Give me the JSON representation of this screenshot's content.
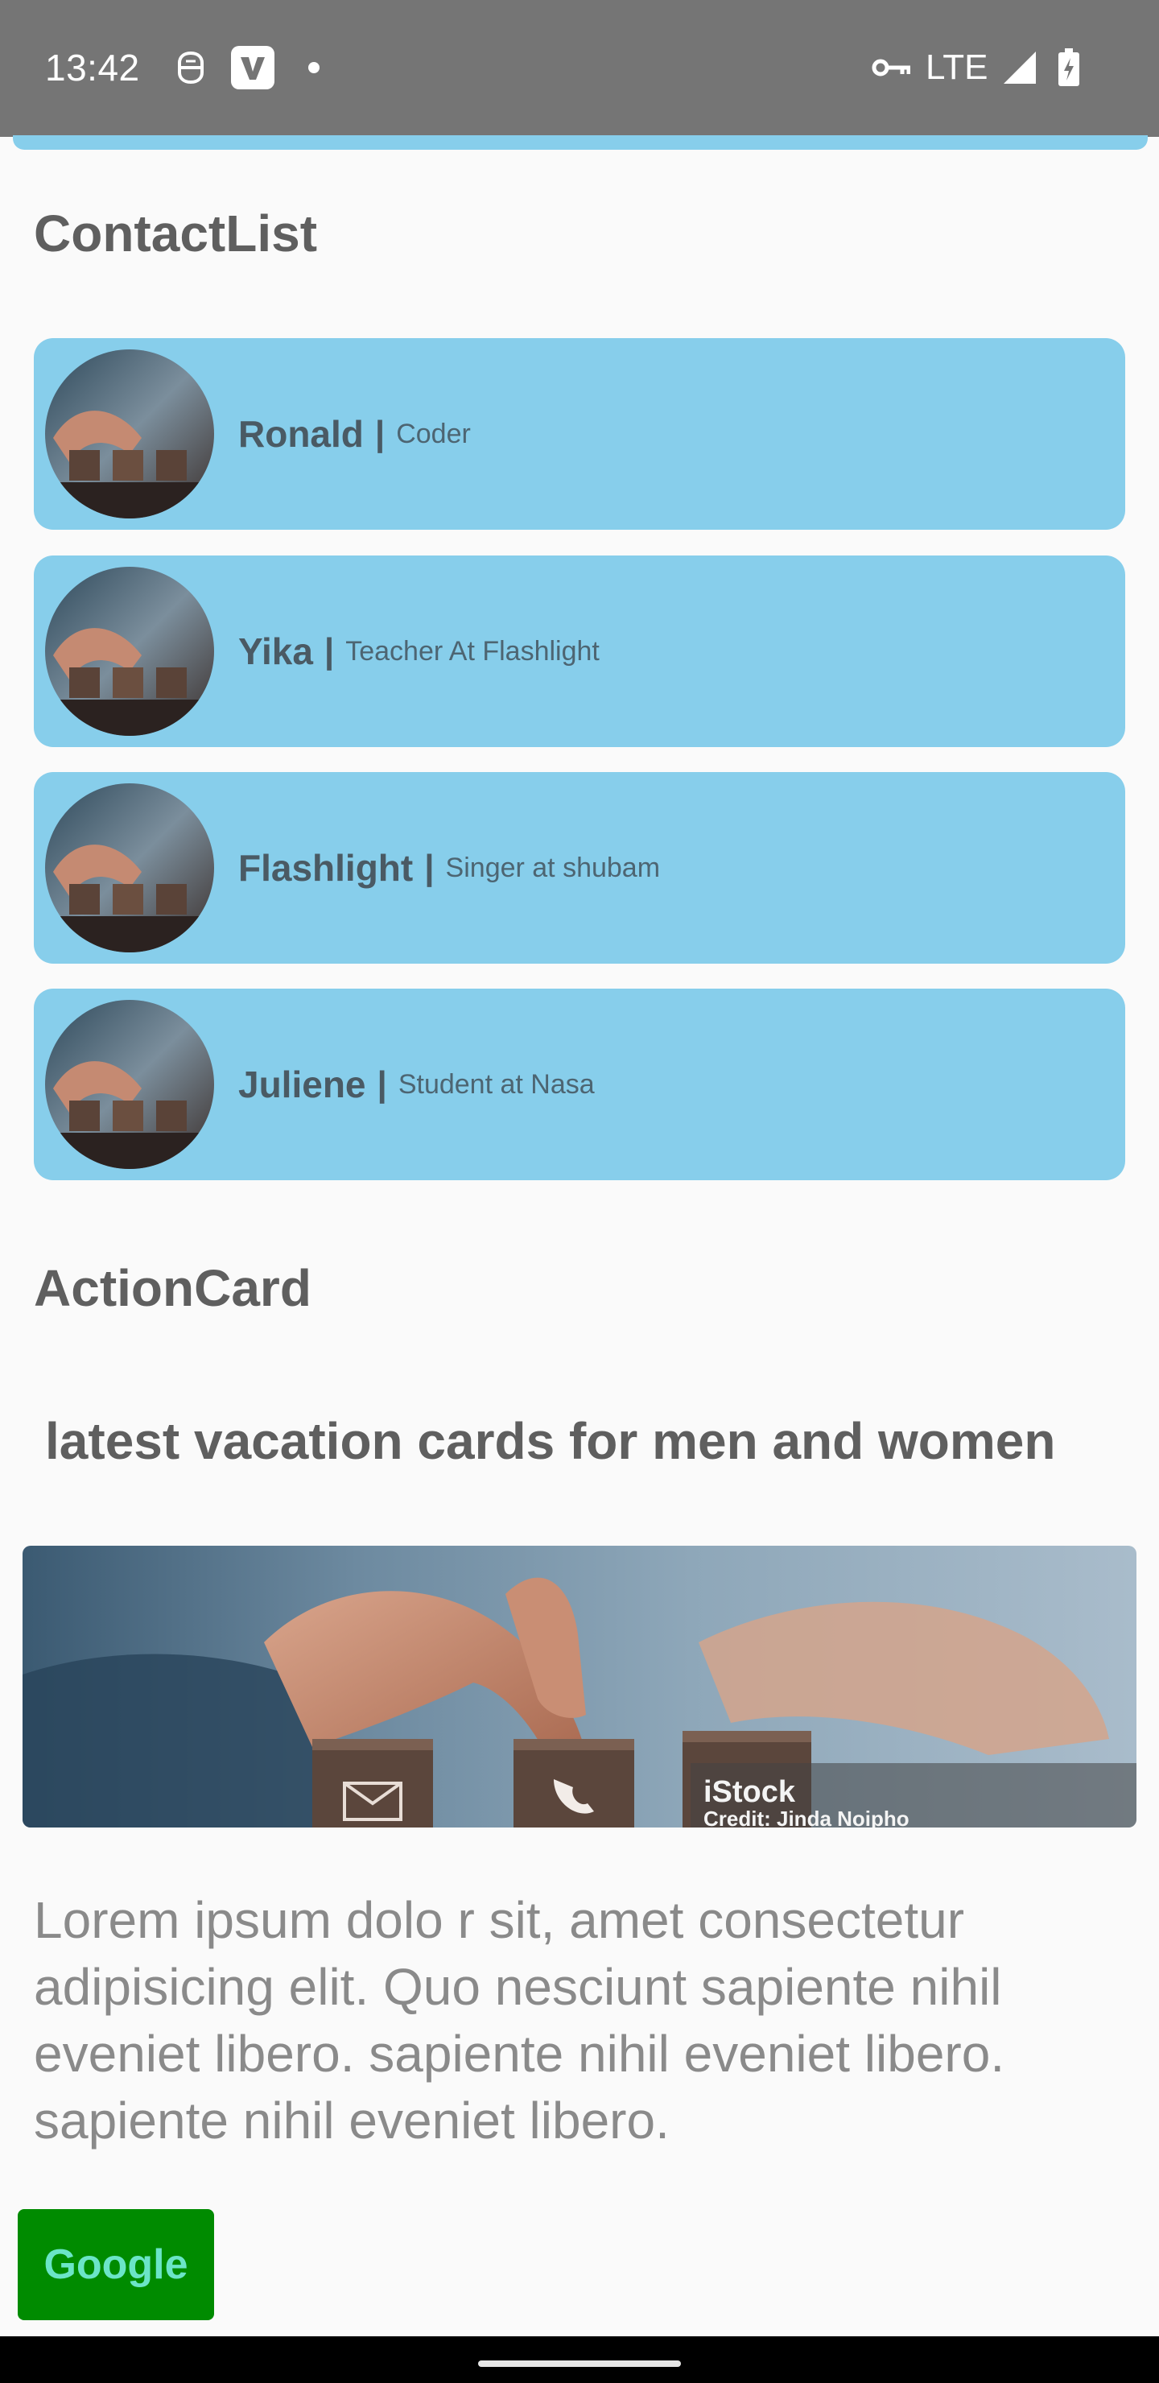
{
  "status_bar": {
    "time": "13:42",
    "network": "LTE",
    "icons": [
      "vpn-icon",
      "v-app-icon",
      "notification-dot-icon",
      "vpn-key-icon",
      "signal-icon",
      "battery-charging-icon"
    ]
  },
  "sections": {
    "contacts_title": "ContactList",
    "action_title": "ActionCard"
  },
  "contacts": [
    {
      "name": "Ronald",
      "separator": "|",
      "role": "Coder"
    },
    {
      "name": "Yika",
      "separator": "|",
      "role": "Teacher At Flashlight"
    },
    {
      "name": "Flashlight",
      "separator": "|",
      "role": "Singer at shubam"
    },
    {
      "name": "Juliene",
      "separator": "|",
      "role": "Student at Nasa"
    }
  ],
  "action_card": {
    "heading": "latest vacation cards for men and women",
    "body": "Lorem ipsum dolo r sit, amet consectetur adipisicing elit. Quo nesciunt sapiente nihil eveniet libero. sapiente nihil eveniet libero. sapiente nihil eveniet libero.",
    "button_label": "Google"
  },
  "colors": {
    "card_bg": "#87ceeb",
    "button_bg": "#008b00",
    "button_text": "#6be5c7",
    "status_bar": "#757575"
  }
}
